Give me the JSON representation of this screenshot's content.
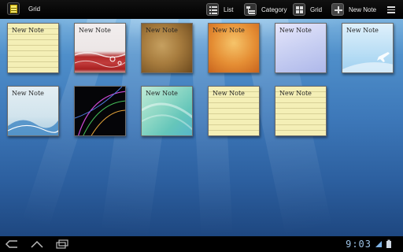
{
  "app": {
    "title": "Grid"
  },
  "actions": [
    {
      "label": "List",
      "icon": "list-icon"
    },
    {
      "label": "Category",
      "icon": "category-icon"
    },
    {
      "label": "Grid",
      "icon": "grid-icon"
    },
    {
      "label": "New Note",
      "icon": "plus-icon"
    }
  ],
  "notes": [
    {
      "title": "New Note",
      "style": "lined-yellow"
    },
    {
      "title": "New Note",
      "style": "red-waves"
    },
    {
      "title": "New Note",
      "style": "parchment"
    },
    {
      "title": "New Note",
      "style": "orange-paper"
    },
    {
      "title": "New Note",
      "style": "lavender"
    },
    {
      "title": "New Note",
      "style": "sky-airplane"
    },
    {
      "title": "New Note",
      "style": "blue-waves"
    },
    {
      "title": "",
      "style": "dark-curves"
    },
    {
      "title": "New Note",
      "style": "green-ribbon"
    },
    {
      "title": "New Note",
      "style": "lined-yellow"
    },
    {
      "title": "New Note",
      "style": "lined-yellow"
    }
  ],
  "status": {
    "clock": "9:03"
  },
  "colors": {
    "accent": "#f3e76a",
    "clock": "#9ec3e6"
  }
}
